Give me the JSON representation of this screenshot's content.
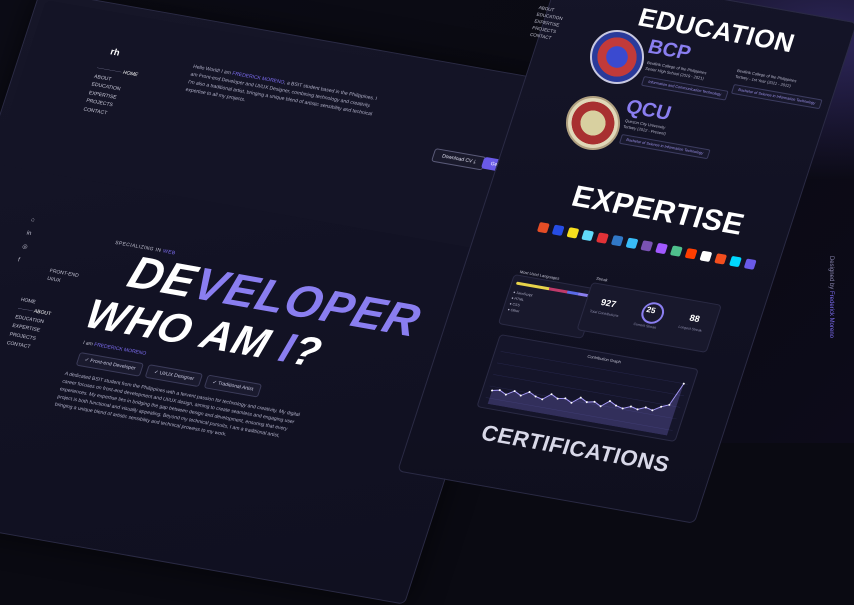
{
  "brand": {
    "logo": "rh"
  },
  "credit": {
    "prefix": "Designed by ",
    "name": "Frederick Moreno"
  },
  "top_nav": {
    "items": [
      "HOME",
      "ABOUT",
      "EDUCATION",
      "EXPERTISE",
      "PROJECTS",
      "CONTACT"
    ],
    "active": "HOME"
  },
  "intro": {
    "prefix": "Hello World! I am ",
    "name": "FREDERICK MORENO",
    "rest": ", a BSIT student based in the Philippines. I am Front-end Developer and UI/UX Designer, combining technology and creativity. I'm also a traditional artist, bringing a unique blend of artistic sensibility and technical expertise to all my projects."
  },
  "actions": {
    "download_cv": "Download CV ⤓",
    "get_in_touch": "Get in touch ➚"
  },
  "socials": [
    "⌂",
    "in",
    "◎",
    "f"
  ],
  "hero": {
    "specializing_prefix": "SPECIALIZING IN ",
    "specializing_hl": "WEB",
    "roles": [
      "FRONT-END",
      "UI/UX"
    ],
    "line1_white": "DE",
    "line1_grad": "VELOPER",
    "line2_white": "WHO AM ",
    "line2_grad": "I",
    "line2_end": "?"
  },
  "side_nav": {
    "items": [
      "HOME",
      "ABOUT",
      "EDUCATION",
      "EXPERTISE",
      "PROJECTS",
      "CONTACT"
    ],
    "active": "ABOUT"
  },
  "about": {
    "iam_prefix": "I am ",
    "iam_name": "FREDERICK MORENO",
    "tags": [
      "✓ Front-end Developer",
      "✓ UI/UX Designer",
      "✓ Traditional Artist"
    ],
    "bio": "A dedicated BSIT student from the Philippines with a fervent passion for technology and creativity. My digital career focuses on front-end development and UI/UX design, aiming to create seamless and engaging user experiences. My expertise lies in bridging the gap between design and development, ensuring that every project is both functional and visually appealing. Beyond my technical pursuits, I am a traditional artist, bringing a unique blend of artistic sensibility and technical prowess to my work."
  },
  "right_nav": {
    "items": [
      "ABOUT",
      "EDUCATION",
      "EXPERTISE",
      "PROJECTS",
      "CONTACT"
    ]
  },
  "education": {
    "title": "EDUCATION",
    "bcp": {
      "name": "BCP",
      "line1": "Bestlink College of the Philippines",
      "line2": "Senior High School (2019 - 2021)",
      "pill": "Information and Communication Technology",
      "right1": "Bestlink College of the Philippines",
      "right2": "Tertiary - 1st Year (2021 - 2022)",
      "right_pill": "Bachelor of Science in Information Technology"
    },
    "qcu": {
      "name": "QCU",
      "line1": "Quezon City University",
      "line2": "Tertiary (2022 - Present)",
      "pill": "Bachelor of Science in Information Technology"
    }
  },
  "expertise": {
    "title": "EXPERTISE",
    "tech_colors": [
      "#e44d26",
      "#264de4",
      "#f7df1e",
      "#61dafb",
      "#e23237",
      "#3178c6",
      "#38bdf8",
      "#7952b3",
      "#a259ff",
      "#4fc08d",
      "#ff3e00",
      "#ffffff",
      "#f24e1e",
      "#00d8ff",
      "#6a5ae8"
    ]
  },
  "stats": {
    "lang_title": "Most Used Languages",
    "langs": [
      "● JavaScript",
      "● HTML",
      "● CSS",
      "● Other"
    ],
    "streak_title": "Streak",
    "total": "927",
    "total_label": "Total Contributions",
    "current": "25",
    "current_label": "Current Streak",
    "longest": "88",
    "longest_label": "Longest Streak"
  },
  "graph": {
    "title": "Contribution Graph",
    "points": [
      6,
      7,
      5,
      8,
      6,
      9,
      7,
      6,
      10,
      8,
      9,
      7,
      11,
      9,
      10,
      8,
      12,
      10,
      9,
      11,
      10,
      12,
      11,
      14,
      16,
      30
    ]
  },
  "certification": {
    "title": "CERTIFICATIONS"
  }
}
